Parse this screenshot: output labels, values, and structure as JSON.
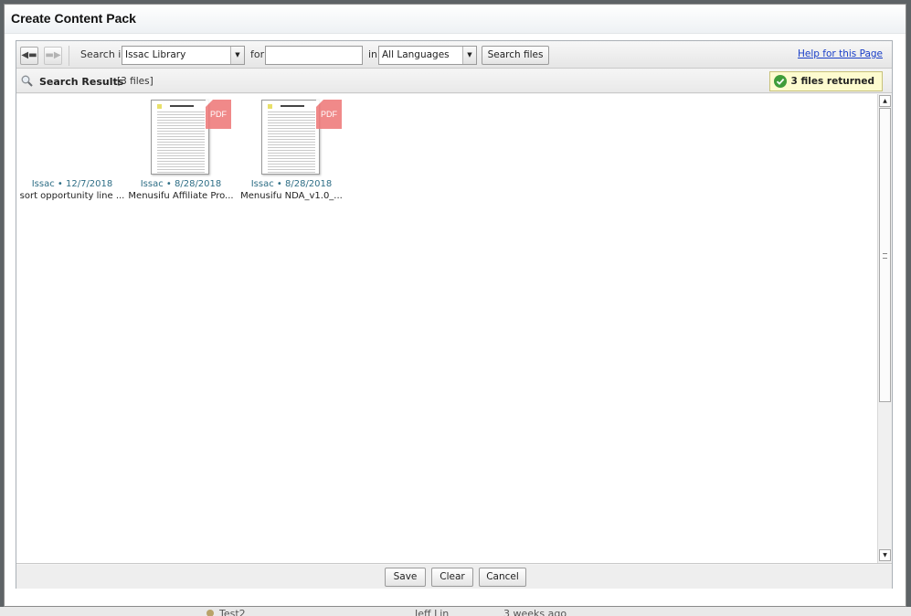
{
  "dialog": {
    "title": "Create Content Pack"
  },
  "toolbar": {
    "back_icon": "arrow-left-icon",
    "forward_icon": "arrow-right-icon",
    "search_in_label": "Search in",
    "library_select": "Issac Library",
    "for_label": "for",
    "query_value": "",
    "in_label": "in",
    "language_select": "All Languages",
    "search_button": "Search files",
    "help_link": "Help for this Page"
  },
  "results": {
    "label": "Search Results",
    "count": "[3 files]",
    "returned": "3 files returned"
  },
  "files": [
    {
      "meta": "Issac • 12/7/2018",
      "name": "sort opportunity line ...",
      "thumbnail": false
    },
    {
      "meta": "Issac • 8/28/2018",
      "name": "Menusifu Affiliate Pro...",
      "thumbnail": true,
      "badge": "PDF"
    },
    {
      "meta": "Issac • 8/28/2018",
      "name": "Menusifu NDA_v1.0_...",
      "thumbnail": true,
      "badge": "PDF"
    }
  ],
  "footer": {
    "save": "Save",
    "clear": "Clear",
    "cancel": "Cancel"
  },
  "background_row": {
    "name": "Test2",
    "author": "Jeff Lin",
    "time": "3 weeks ago"
  },
  "colors": {
    "accent_link": "#1a3fc8",
    "meta_text": "#2e6e86",
    "pdf_badge": "#ef7d7d",
    "success": "#3f9d3a",
    "notice_bg": "#fdfbcf"
  }
}
